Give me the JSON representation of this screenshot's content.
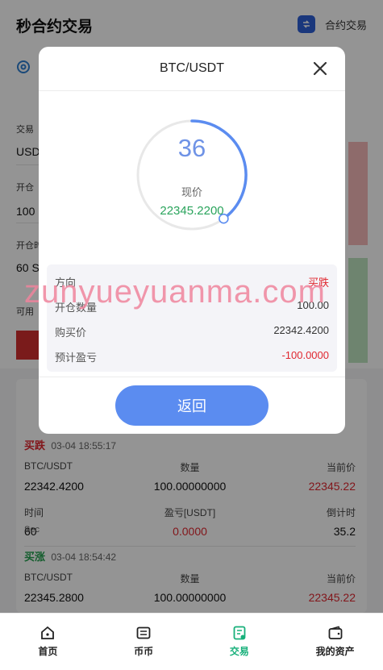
{
  "header": {
    "title": "秒合约交易",
    "switch_label": "合约交易"
  },
  "form": {
    "label1": "交易",
    "value1": "USD",
    "label2": "开仓",
    "value2": "100",
    "label3": "开仓时",
    "value3": "60 S",
    "label4": "可用"
  },
  "orders": [
    {
      "direction": "买跌",
      "direction_color": "#e0272f",
      "time": "03-04 18:55:17",
      "pair": "BTC/USDT",
      "qty_label": "数量",
      "cur_label": "当前价",
      "buy_price": "22342.4200",
      "qty": "100.00000000",
      "cur_price": "22345.22",
      "time_label": "时间",
      "pnl_label": "盈亏[USDT]",
      "countdown_label": "倒计时",
      "duration": "60",
      "duration_unit": "Sec",
      "pnl": "0.0000",
      "countdown": "35.2"
    },
    {
      "direction": "买涨",
      "direction_color": "#23a14f",
      "time": "03-04 18:54:42",
      "pair": "BTC/USDT",
      "qty_label": "数量",
      "cur_label": "当前价",
      "buy_price": "22345.2800",
      "qty": "100.00000000",
      "cur_price": "22345.22"
    }
  ],
  "tabs": [
    {
      "label": "首页",
      "icon": "home-icon"
    },
    {
      "label": "币币",
      "icon": "exchange-icon"
    },
    {
      "label": "交易",
      "icon": "trade-icon",
      "active": true
    },
    {
      "label": "我的资产",
      "icon": "wallet-icon"
    }
  ],
  "modal": {
    "title": "BTC/USDT",
    "countdown": "36",
    "countdown_progress": 0.4,
    "price_label": "现价",
    "price_value": "22345.2200",
    "rows": [
      {
        "label": "方向",
        "value": "买跌",
        "color": "#e0272f"
      },
      {
        "label": "开仓数量",
        "value": "100.00",
        "color": "#333333"
      },
      {
        "label": "购买价",
        "value": "22342.4200",
        "color": "#333333"
      },
      {
        "label": "预计盈亏",
        "value": "-100.0000",
        "color": "#e0272f"
      }
    ],
    "back_label": "返回"
  },
  "watermark": "zunyueyuanma.com",
  "colors": {
    "accent": "#5b8cf0",
    "up": "#23a14f",
    "down": "#e0272f",
    "tab_active": "#17b07a"
  }
}
